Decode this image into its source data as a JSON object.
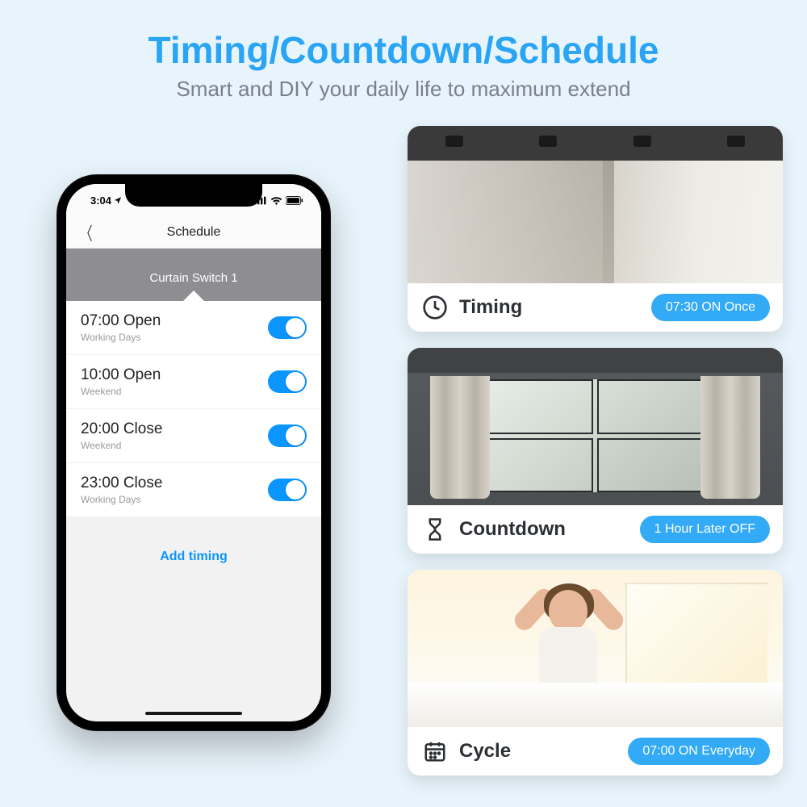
{
  "header": {
    "title": "Timing/Countdown/Schedule",
    "subtitle": "Smart and DIY your daily life to maximum extend"
  },
  "phone": {
    "status": {
      "time": "3:04",
      "right_icons": "signal wifi battery"
    },
    "screen_title": "Schedule",
    "device_name": "Curtain Switch 1",
    "schedules": [
      {
        "label": "07:00 Open",
        "subtitle": "Working Days",
        "on": true
      },
      {
        "label": "10:00 Open",
        "subtitle": "Weekend",
        "on": true
      },
      {
        "label": "20:00 Close",
        "subtitle": "Weekend",
        "on": true
      },
      {
        "label": "23:00 Close",
        "subtitle": "Working Days",
        "on": true
      }
    ],
    "add_timing": "Add timing"
  },
  "cards": [
    {
      "icon": "clock",
      "label": "Timing",
      "badge": "07:30 ON Once"
    },
    {
      "icon": "hourglass",
      "label": "Countdown",
      "badge": "1 Hour Later OFF"
    },
    {
      "icon": "calendar",
      "label": "Cycle",
      "badge": "07:00 ON Everyday"
    }
  ]
}
